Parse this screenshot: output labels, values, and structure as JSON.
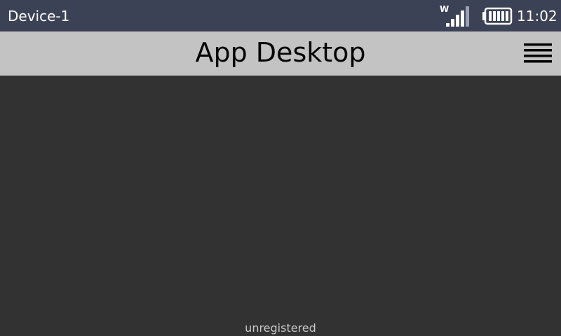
{
  "status_bar": {
    "device_name": "Device-1",
    "wifi_label": "W",
    "signal_icon": "signal-strength-icon",
    "battery_icon": "battery-full-icon",
    "time": "11:02"
  },
  "header": {
    "title": "App Desktop",
    "menu_icon": "hamburger-menu-icon"
  },
  "main": {
    "registration_status": "unregistered"
  },
  "colors": {
    "status_bar_bg": "#3c4256",
    "title_bar_bg": "#c3c3c3",
    "desktop_bg": "#323232",
    "signal_inactive": "#9ba0b4"
  }
}
